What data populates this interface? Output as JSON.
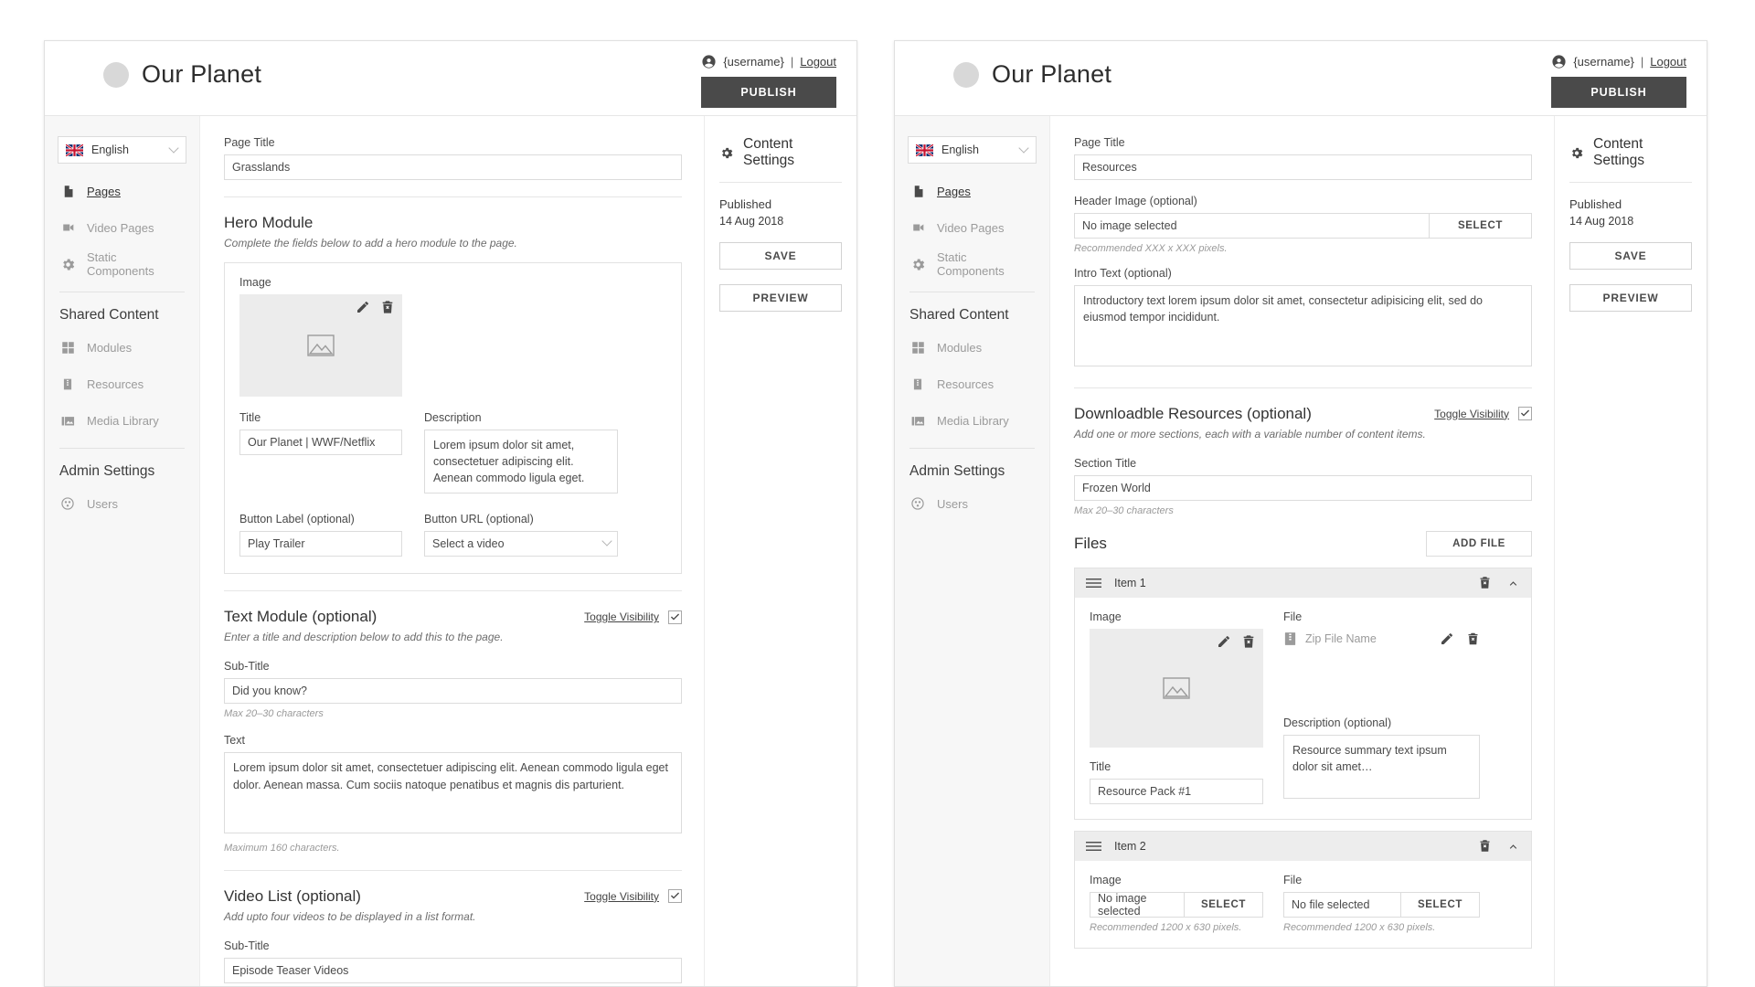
{
  "header": {
    "brand": "Our Planet",
    "username": "{username}",
    "separator": "|",
    "logout": "Logout",
    "publish": "PUBLISH"
  },
  "sidebar": {
    "language": "English",
    "items": [
      {
        "label": "Pages",
        "icon": "page-icon",
        "active": true
      },
      {
        "label": "Video Pages",
        "icon": "video-icon",
        "active": false
      },
      {
        "label": "Static Components",
        "icon": "gear-icon",
        "active": false
      }
    ],
    "shared_heading": "Shared Content",
    "shared_items": [
      {
        "label": "Modules",
        "icon": "modules-icon"
      },
      {
        "label": "Resources",
        "icon": "resources-icon"
      },
      {
        "label": "Media Library",
        "icon": "media-library-icon"
      }
    ],
    "admin_heading": "Admin Settings",
    "admin_items": [
      {
        "label": "Users",
        "icon": "users-icon"
      }
    ]
  },
  "settings": {
    "title": "Content Settings",
    "status_label": "Published",
    "status_date": "14 Aug 2018",
    "save": "SAVE",
    "preview": "PREVIEW"
  },
  "left_panel": {
    "page_title_label": "Page Title",
    "page_title_value": "Grasslands",
    "hero": {
      "title": "Hero Module",
      "subtitle": "Complete the fields below to add a hero module to the page.",
      "image_label": "Image",
      "title_label": "Title",
      "title_value": "Our Planet | WWF/Netflix",
      "description_label": "Description",
      "description_value": "Lorem ipsum dolor sit amet, consectetuer adipiscing elit. Aenean commodo ligula eget.",
      "button_label_label": "Button Label (optional)",
      "button_label_value": "Play Trailer",
      "button_url_label": "Button URL (optional)",
      "button_url_value": "Select a video"
    },
    "text_module": {
      "title": "Text Module (optional)",
      "toggle_label": "Toggle Visibility",
      "toggle_checked": true,
      "subtitle": "Enter a title and description below to add this to the page.",
      "subtitle_label": "Sub-Title",
      "subtitle_value": "Did you know?",
      "subtitle_hint": "Max 20–30 characters",
      "text_label": "Text",
      "text_value": "Lorem ipsum dolor sit amet, consectetuer adipiscing elit. Aenean commodo ligula eget dolor. Aenean massa. Cum sociis natoque penatibus et magnis dis parturient.",
      "text_hint": "Maximum 160 characters."
    },
    "video_list": {
      "title": "Video List (optional)",
      "toggle_label": "Toggle Visibility",
      "toggle_checked": true,
      "subtitle": "Add upto four videos to be displayed in a list format.",
      "subtitle_label": "Sub-Title",
      "subtitle_value": "Episode Teaser Videos"
    }
  },
  "right_panel": {
    "page_title_label": "Page Title",
    "page_title_value": "Resources",
    "header_image_label": "Header Image (optional)",
    "header_image_value": "No image selected",
    "header_image_button": "SELECT",
    "header_image_hint": "Recommended XXX x XXX pixels.",
    "intro_label": "Intro Text (optional)",
    "intro_value": "Introductory text lorem ipsum dolor sit amet, consectetur adipisicing elit, sed do eiusmod tempor incididunt.",
    "downloadable": {
      "title": "Downloadble Resources (optional)",
      "toggle_label": "Toggle Visibility",
      "toggle_checked": true,
      "subtitle": "Add one or more sections, each with a variable number of content items.",
      "section_title_label": "Section Title",
      "section_title_value": "Frozen World",
      "section_title_hint": "Max 20–30 characters"
    },
    "files": {
      "heading": "Files",
      "add_button": "ADD FILE",
      "items": [
        {
          "name": "Item 1",
          "image_label": "Image",
          "file_label": "File",
          "file_name": "Zip File Name",
          "title_label": "Title",
          "title_value": "Resource Pack #1",
          "description_label": "Description (optional)",
          "description_value": "Resource summary text ipsum dolor sit amet…"
        },
        {
          "name": "Item 2",
          "image_label": "Image",
          "image_value": "No image selected",
          "image_button": "SELECT",
          "image_hint": "Recommended 1200 x 630 pixels.",
          "file_label": "File",
          "file_value": "No file selected",
          "file_button": "SELECT",
          "file_hint": "Recommended 1200 x 630 pixels."
        }
      ]
    }
  },
  "colors": {
    "publish_bg": "#4a4a4a",
    "panel_border": "#e0e0e0",
    "sidebar_bg": "#f7f7f7",
    "item_head_bg": "#ededed",
    "placeholder_bg": "#ececec"
  }
}
